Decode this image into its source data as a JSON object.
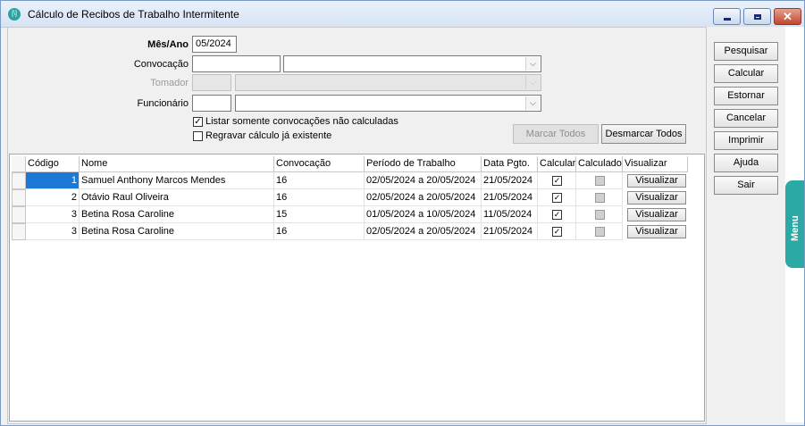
{
  "window": {
    "title": "Cálculo de Recibos de Trabalho Intermitente",
    "app_icon_text": "[\\]"
  },
  "form": {
    "mes_ano_label": "Mês/Ano",
    "mes_ano_value": "05/2024",
    "convocacao_label": "Convocação",
    "convocacao_code": "",
    "convocacao_desc": "",
    "tomador_label": "Tomador",
    "tomador_code": "",
    "tomador_desc": "",
    "funcionario_label": "Funcionário",
    "funcionario_code": "",
    "funcionario_desc": "",
    "listar_label": "Listar somente convocações não calculadas",
    "listar_checked": true,
    "regravar_label": "Regravar cálculo já existente",
    "regravar_checked": false,
    "marcar_todos": "Marcar Todos",
    "desmarcar_todos": "Desmarcar Todos"
  },
  "grid": {
    "columns": [
      "Código",
      "Nome",
      "Convocação",
      "Período de Trabalho",
      "Data Pgto.",
      "Calcular",
      "Calculado",
      "Visualizar"
    ],
    "rows": [
      {
        "codigo": "1",
        "nome": "Samuel Anthony Marcos Mendes",
        "convocacao": "16",
        "periodo": "02/05/2024 a 20/05/2024",
        "data_pgto": "21/05/2024",
        "calcular": true,
        "calculado": false,
        "visualizar": "Visualizar"
      },
      {
        "codigo": "2",
        "nome": "Otávio Raul Oliveira",
        "convocacao": "16",
        "periodo": "02/05/2024 a 20/05/2024",
        "data_pgto": "21/05/2024",
        "calcular": true,
        "calculado": false,
        "visualizar": "Visualizar"
      },
      {
        "codigo": "3",
        "nome": "Betina Rosa Caroline",
        "convocacao": "15",
        "periodo": "01/05/2024 a 10/05/2024",
        "data_pgto": "11/05/2024",
        "calcular": true,
        "calculado": false,
        "visualizar": "Visualizar"
      },
      {
        "codigo": "3",
        "nome": "Betina Rosa Caroline",
        "convocacao": "16",
        "periodo": "02/05/2024 a 20/05/2024",
        "data_pgto": "21/05/2024",
        "calcular": true,
        "calculado": false,
        "visualizar": "Visualizar"
      }
    ]
  },
  "side_buttons": [
    {
      "label": "Pesquisar"
    },
    {
      "label": "Calcular"
    },
    {
      "label": "Estornar"
    },
    {
      "label": "Cancelar"
    },
    {
      "label": "Imprimir"
    },
    {
      "label": "Ajuda"
    },
    {
      "label": "Sair"
    }
  ],
  "menu_tab": "Menu",
  "colors": {
    "accent": "#2aa9a5",
    "selection": "#1e78d7"
  }
}
